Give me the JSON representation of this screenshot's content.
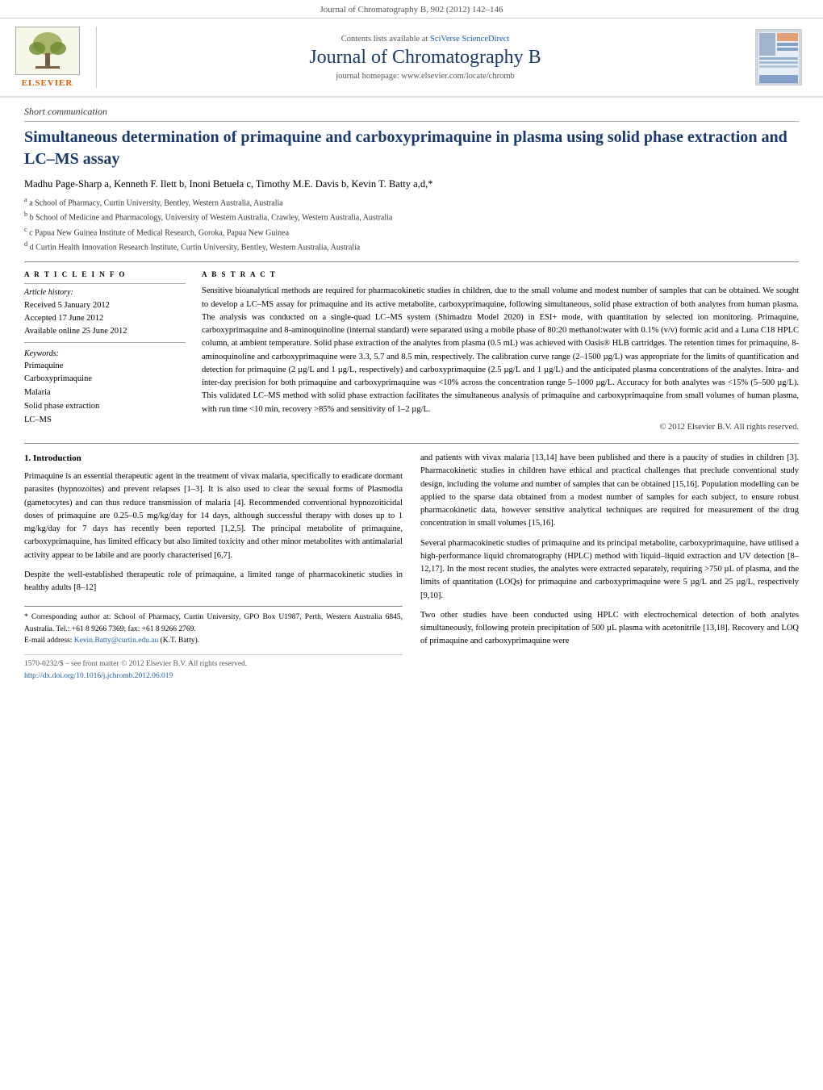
{
  "topbar": {
    "text": "Journal of Chromatography B, 902 (2012) 142–146"
  },
  "header": {
    "elsevier_label": "ELSEVIER",
    "contents_text": "Contents lists available at",
    "contents_link_text": "SciVerse ScienceDirect",
    "journal_title": "Journal of Chromatography B",
    "homepage_text": "journal homepage: www.elsevier.com/locate/chromb",
    "homepage_url": "www.elsevier.com/locate/chromb"
  },
  "article": {
    "type_label": "Short communication",
    "title": "Simultaneous determination of primaquine and carboxyprimaquine in plasma using solid phase extraction and LC–MS assay",
    "authors": "Madhu Page-Sharp a, Kenneth F. Ilett b, Inoni Betuela c, Timothy M.E. Davis b, Kevin T. Batty a,d,*",
    "affiliations": [
      "a School of Pharmacy, Curtin University, Bentley, Western Australia, Australia",
      "b School of Medicine and Pharmacology, University of Western Australia, Crawley, Western Australia, Australia",
      "c Papua New Guinea Institute of Medical Research, Goroka, Papua New Guinea",
      "d Curtin Health Innovation Research Institute, Curtin University, Bentley, Western Australia, Australia"
    ]
  },
  "article_info": {
    "section_head": "A R T I C L E  I N F O",
    "history_label": "Article history:",
    "received": "Received 5 January 2012",
    "accepted": "Accepted 17 June 2012",
    "online": "Available online 25 June 2012",
    "keywords_label": "Keywords:",
    "keywords": [
      "Primaquine",
      "Carboxyprimaquine",
      "Malaria",
      "Solid phase extraction",
      "LC–MS"
    ]
  },
  "abstract": {
    "section_head": "A B S T R A C T",
    "text": "Sensitive bioanalytical methods are required for pharmacokinetic studies in children, due to the small volume and modest number of samples that can be obtained. We sought to develop a LC–MS assay for primaquine and its active metabolite, carboxyprimaquine, following simultaneous, solid phase extraction of both analytes from human plasma. The analysis was conducted on a single-quad LC–MS system (Shimadzu Model 2020) in ESI+ mode, with quantitation by selected ion monitoring. Primaquine, carboxyprimaquine and 8-aminoquinoline (internal standard) were separated using a mobile phase of 80:20 methanol:water with 0.1% (v/v) formic acid and a Luna C18 HPLC column, at ambient temperature. Solid phase extraction of the analytes from plasma (0.5 mL) was achieved with Oasis® HLB cartridges. The retention times for primaquine, 8-aminoquinoline and carboxyprimaquine were 3.3, 5.7 and 8.5 min, respectively. The calibration curve range (2–1500 µg/L) was appropriate for the limits of quantification and detection for primaquine (2 µg/L and 1 µg/L, respectively) and carboxyprimaquine (2.5 µg/L and 1 µg/L) and the anticipated plasma concentrations of the analytes. Intra- and inter-day precision for both primaquine and carboxyprimaquine was <10% across the concentration range 5–1000 µg/L. Accuracy for both analytes was <15% (5–500 µg/L). This validated LC–MS method with solid phase extraction facilitates the simultaneous analysis of primaquine and carboxyprimaquine from small volumes of human plasma, with run time <10 min, recovery >85% and sensitivity of 1–2 µg/L.",
    "copyright": "© 2012 Elsevier B.V. All rights reserved."
  },
  "intro": {
    "section_number": "1.",
    "section_title": "Introduction",
    "para1": "Primaquine is an essential therapeutic agent in the treatment of vivax malaria, specifically to eradicate dormant parasites (hypnozoites) and prevent relapses [1–3]. It is also used to clear the sexual forms of Plasmodia (gametocytes) and can thus reduce transmission of malaria [4]. Recommended conventional hypnozoiticidal doses of primaquine are 0.25–0.5 mg/kg/day for 14 days, although successful therapy with doses up to 1 mg/kg/day for 7 days has recently been reported [1,2,5]. The principal metabolite of primaquine, carboxyprimaquine, has limited efficacy but also limited toxicity and other minor metabolites with antimalarial activity appear to be labile and are poorly characterised [6,7].",
    "para2": "Despite the well-established therapeutic role of primaquine, a limited range of pharmacokinetic studies in healthy adults [8–12]"
  },
  "right_col": {
    "para1": "and patients with vivax malaria [13,14] have been published and there is a paucity of studies in children [3]. Pharmacokinetic studies in children have ethical and practical challenges that preclude conventional study design, including the volume and number of samples that can be obtained [15,16]. Population modelling can be applied to the sparse data obtained from a modest number of samples for each subject, to ensure robust pharmacokinetic data, however sensitive analytical techniques are required for measurement of the drug concentration in small volumes [15,16].",
    "para2": "Several pharmacokinetic studies of primaquine and its principal metabolite, carboxyprimaquine, have utilised a high-performance liquid chromatography (HPLC) method with liquid–liquid extraction and UV detection [8–12,17]. In the most recent studies, the analytes were extracted separately, requiring >750 µL of plasma, and the limits of quantitation (LOQs) for primaquine and carboxyprimaquine were 5 µg/L and 25 µg/L, respectively [9,10].",
    "para3": "Two other studies have been conducted using HPLC with electrochemical detection of both analytes simultaneously, following protein precipitation of 500 µL plasma with acetonitrile [13,18]. Recovery and LOQ of primaquine and carboxyprimaquine were"
  },
  "footnotes": {
    "star": "* Corresponding author at: School of Pharmacy, Curtin University, GPO Box U1987, Perth, Western Australia 6845, Australia. Tel.: +61 8 9266 7369; fax: +61 8 9266 2769.",
    "email_label": "E-mail address:",
    "email": "Kevin.Batty@curtin.edu.au",
    "email_note": " (K.T. Batty)."
  },
  "bottom": {
    "issn": "1570-0232/$ – see front matter © 2012 Elsevier B.V. All rights reserved.",
    "doi_label": "http://dx.doi.org/10.1016/j.jchromb.2012.06.019"
  }
}
